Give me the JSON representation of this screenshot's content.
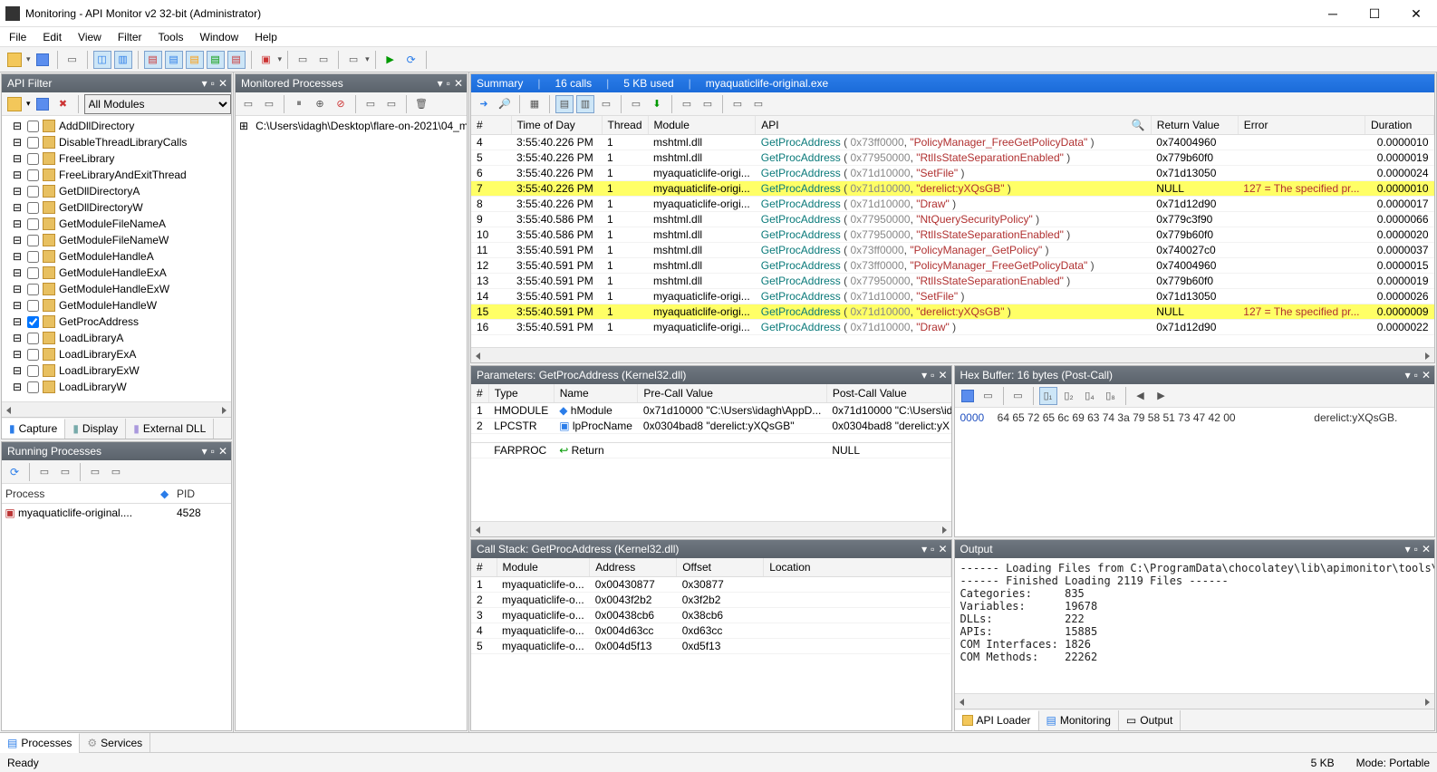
{
  "window": {
    "title": "Monitoring - API Monitor v2 32-bit (Administrator)"
  },
  "menu": [
    "File",
    "Edit",
    "View",
    "Filter",
    "Tools",
    "Window",
    "Help"
  ],
  "api_filter": {
    "title": "API Filter",
    "combo": "All Modules",
    "items": [
      {
        "label": "AddDllDirectory",
        "checked": false
      },
      {
        "label": "DisableThreadLibraryCalls",
        "checked": false
      },
      {
        "label": "FreeLibrary",
        "checked": false
      },
      {
        "label": "FreeLibraryAndExitThread",
        "checked": false
      },
      {
        "label": "GetDllDirectoryA",
        "checked": false
      },
      {
        "label": "GetDllDirectoryW",
        "checked": false
      },
      {
        "label": "GetModuleFileNameA",
        "checked": false
      },
      {
        "label": "GetModuleFileNameW",
        "checked": false
      },
      {
        "label": "GetModuleHandleA",
        "checked": false
      },
      {
        "label": "GetModuleHandleExA",
        "checked": false
      },
      {
        "label": "GetModuleHandleExW",
        "checked": false
      },
      {
        "label": "GetModuleHandleW",
        "checked": false
      },
      {
        "label": "GetProcAddress",
        "checked": true
      },
      {
        "label": "LoadLibraryA",
        "checked": false
      },
      {
        "label": "LoadLibraryExA",
        "checked": false
      },
      {
        "label": "LoadLibraryExW",
        "checked": false
      },
      {
        "label": "LoadLibraryW",
        "checked": false
      }
    ],
    "tabs": {
      "capture": "Capture",
      "display": "Display",
      "external": "External DLL"
    }
  },
  "running_processes": {
    "title": "Running Processes",
    "headers": {
      "process": "Process",
      "pid": "PID"
    },
    "rows": [
      {
        "name": "myaquaticlife-original....",
        "pid": "4528"
      }
    ]
  },
  "monitored_processes": {
    "title": "Monitored Processes",
    "path": "C:\\Users\\idagh\\Desktop\\flare-on-2021\\04_m"
  },
  "summary": {
    "title": "Summary",
    "calls": "16 calls",
    "mem": "5 KB used",
    "proc": "myaquaticlife-original.exe",
    "headers": {
      "n": "#",
      "time": "Time of Day",
      "thread": "Thread",
      "module": "Module",
      "api": "API",
      "ret": "Return Value",
      "err": "Error",
      "dur": "Duration"
    },
    "rows": [
      {
        "n": 4,
        "time": "3:55:40.226 PM",
        "thread": 1,
        "module": "mshtml.dll",
        "fn": "GetProcAddress",
        "addr": "0x73ff0000",
        "arg": "\"PolicyManager_FreeGetPolicyData\"",
        "ret": "0x74004960",
        "err": "",
        "dur": "0.0000010",
        "hl": false
      },
      {
        "n": 5,
        "time": "3:55:40.226 PM",
        "thread": 1,
        "module": "mshtml.dll",
        "fn": "GetProcAddress",
        "addr": "0x77950000",
        "arg": "\"RtlIsStateSeparationEnabled\"",
        "ret": "0x779b60f0",
        "err": "",
        "dur": "0.0000019",
        "hl": false
      },
      {
        "n": 6,
        "time": "3:55:40.226 PM",
        "thread": 1,
        "module": "myaquaticlife-origi...",
        "fn": "GetProcAddress",
        "addr": "0x71d10000",
        "arg": "\"SetFile\"",
        "ret": "0x71d13050",
        "err": "",
        "dur": "0.0000024",
        "hl": false
      },
      {
        "n": 7,
        "time": "3:55:40.226 PM",
        "thread": 1,
        "module": "myaquaticlife-origi...",
        "fn": "GetProcAddress",
        "addr": "0x71d10000",
        "arg": "\"derelict:yXQsGB\"",
        "ret": "NULL",
        "err": "127 = The specified pr...",
        "dur": "0.0000010",
        "hl": true
      },
      {
        "n": 8,
        "time": "3:55:40.226 PM",
        "thread": 1,
        "module": "myaquaticlife-origi...",
        "fn": "GetProcAddress",
        "addr": "0x71d10000",
        "arg": "\"Draw\"",
        "ret": "0x71d12d90",
        "err": "",
        "dur": "0.0000017",
        "hl": false
      },
      {
        "n": 9,
        "time": "3:55:40.586 PM",
        "thread": 1,
        "module": "mshtml.dll",
        "fn": "GetProcAddress",
        "addr": "0x77950000",
        "arg": "\"NtQuerySecurityPolicy\"",
        "ret": "0x779c3f90",
        "err": "",
        "dur": "0.0000066",
        "hl": false
      },
      {
        "n": 10,
        "time": "3:55:40.586 PM",
        "thread": 1,
        "module": "mshtml.dll",
        "fn": "GetProcAddress",
        "addr": "0x77950000",
        "arg": "\"RtlIsStateSeparationEnabled\"",
        "ret": "0x779b60f0",
        "err": "",
        "dur": "0.0000020",
        "hl": false
      },
      {
        "n": 11,
        "time": "3:55:40.591 PM",
        "thread": 1,
        "module": "mshtml.dll",
        "fn": "GetProcAddress",
        "addr": "0x73ff0000",
        "arg": "\"PolicyManager_GetPolicy\"",
        "ret": "0x740027c0",
        "err": "",
        "dur": "0.0000037",
        "hl": false
      },
      {
        "n": 12,
        "time": "3:55:40.591 PM",
        "thread": 1,
        "module": "mshtml.dll",
        "fn": "GetProcAddress",
        "addr": "0x73ff0000",
        "arg": "\"PolicyManager_FreeGetPolicyData\"",
        "ret": "0x74004960",
        "err": "",
        "dur": "0.0000015",
        "hl": false
      },
      {
        "n": 13,
        "time": "3:55:40.591 PM",
        "thread": 1,
        "module": "mshtml.dll",
        "fn": "GetProcAddress",
        "addr": "0x77950000",
        "arg": "\"RtlIsStateSeparationEnabled\"",
        "ret": "0x779b60f0",
        "err": "",
        "dur": "0.0000019",
        "hl": false
      },
      {
        "n": 14,
        "time": "3:55:40.591 PM",
        "thread": 1,
        "module": "myaquaticlife-origi...",
        "fn": "GetProcAddress",
        "addr": "0x71d10000",
        "arg": "\"SetFile\"",
        "ret": "0x71d13050",
        "err": "",
        "dur": "0.0000026",
        "hl": false
      },
      {
        "n": 15,
        "time": "3:55:40.591 PM",
        "thread": 1,
        "module": "myaquaticlife-origi...",
        "fn": "GetProcAddress",
        "addr": "0x71d10000",
        "arg": "\"derelict:yXQsGB\"",
        "ret": "NULL",
        "err": "127 = The specified pr...",
        "dur": "0.0000009",
        "hl": true
      },
      {
        "n": 16,
        "time": "3:55:40.591 PM",
        "thread": 1,
        "module": "myaquaticlife-origi...",
        "fn": "GetProcAddress",
        "addr": "0x71d10000",
        "arg": "\"Draw\"",
        "ret": "0x71d12d90",
        "err": "",
        "dur": "0.0000022",
        "hl": false
      }
    ]
  },
  "parameters": {
    "title": "Parameters: GetProcAddress (Kernel32.dll)",
    "headers": {
      "n": "#",
      "type": "Type",
      "name": "Name",
      "pre": "Pre-Call Value",
      "post": "Post-Call Value"
    },
    "rows": [
      {
        "n": 1,
        "type": "HMODULE",
        "name": "hModule",
        "pre": "0x71d10000 \"C:\\Users\\idagh\\AppD...",
        "post": "0x71d10000 \"C:\\Users\\id"
      },
      {
        "n": 2,
        "type": "LPCSTR",
        "name": "lpProcName",
        "pre": "0x0304bad8 \"derelict:yXQsGB\"",
        "post": "0x0304bad8 \"derelict:yX"
      }
    ],
    "ret": {
      "type": "FARPROC",
      "name": "Return",
      "post": "NULL"
    }
  },
  "hex": {
    "title": "Hex Buffer: 16 bytes (Post-Call)",
    "offset": "0000",
    "bytes": "64 65 72 65 6c 69 63 74 3a 79 58 51 73 47 42 00",
    "ascii": "derelict:yXQsGB."
  },
  "callstack": {
    "title": "Call Stack: GetProcAddress (Kernel32.dll)",
    "headers": {
      "n": "#",
      "module": "Module",
      "address": "Address",
      "offset": "Offset",
      "location": "Location"
    },
    "rows": [
      {
        "n": 1,
        "module": "myaquaticlife-o...",
        "address": "0x00430877",
        "offset": "0x30877",
        "location": ""
      },
      {
        "n": 2,
        "module": "myaquaticlife-o...",
        "address": "0x0043f2b2",
        "offset": "0x3f2b2",
        "location": ""
      },
      {
        "n": 3,
        "module": "myaquaticlife-o...",
        "address": "0x00438cb6",
        "offset": "0x38cb6",
        "location": ""
      },
      {
        "n": 4,
        "module": "myaquaticlife-o...",
        "address": "0x004d63cc",
        "offset": "0xd63cc",
        "location": ""
      },
      {
        "n": 5,
        "module": "myaquaticlife-o...",
        "address": "0x004d5f13",
        "offset": "0xd5f13",
        "location": ""
      }
    ]
  },
  "output": {
    "title": "Output",
    "text": "------ Loading Files from C:\\ProgramData\\chocolatey\\lib\\apimonitor\\tools\\API Monitor (roh:\n------ Finished Loading 2119 Files ------\nCategories:     835\nVariables:      19678\nDLLs:           222\nAPIs:           15885\nCOM Interfaces: 1826\nCOM Methods:    22262",
    "tabs": {
      "apiloader": "API Loader",
      "monitoring": "Monitoring",
      "output": "Output"
    }
  },
  "bottom_tabs": {
    "processes": "Processes",
    "services": "Services"
  },
  "status": {
    "ready": "Ready",
    "size": "5 KB",
    "mode": "Mode: Portable"
  }
}
